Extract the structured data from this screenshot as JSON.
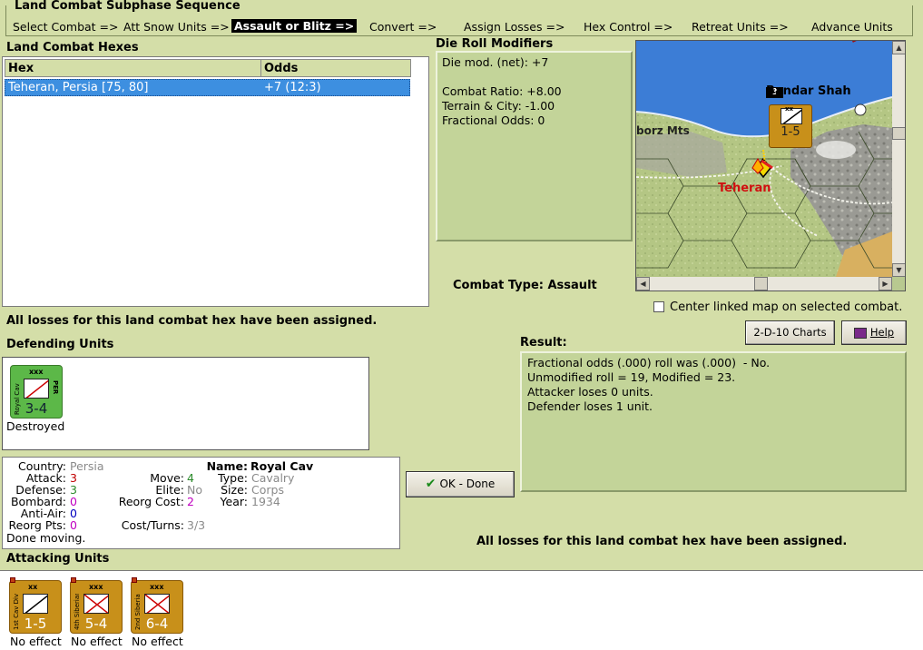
{
  "sequence": {
    "title": "Land Combat Subphase Sequence",
    "steps": [
      "Select Combat =>",
      "Att Snow Units =>",
      "Assault or Blitz =>",
      "Convert =>",
      "Assign Losses =>",
      "Hex Control =>",
      "Retreat Units =>",
      "Advance Units"
    ],
    "active_index": 2
  },
  "hexes": {
    "title": "Land Combat Hexes",
    "columns": [
      "Hex",
      "Odds"
    ],
    "rows": [
      {
        "hex": "Teheran, Persia [75, 80]",
        "odds": "+7 (12:3)"
      }
    ]
  },
  "drm": {
    "title": "Die Roll Modifiers",
    "lines": [
      "Die mod. (net): +7",
      "",
      "Combat Ratio: +8.00",
      "Terrain & City: -1.00",
      "Fractional Odds: 0"
    ]
  },
  "map": {
    "labels": {
      "bandar": "Bandar Shah",
      "elburz": "borz Mts",
      "teheran": "Teheran"
    },
    "stack_count": "3",
    "unit": {
      "size": "xx",
      "strength": "1-5",
      "name": "1st Cav"
    }
  },
  "combat_type": {
    "label": "Combat Type:",
    "value": "Assault"
  },
  "center_map_label": "Center linked map on selected combat.",
  "losses_msg": "All losses for this land combat hex have been assigned.",
  "losses_msg_right": "All losses for this land combat hex have been assigned.",
  "buttons": {
    "charts": "2-D-10 Charts",
    "help": "Help",
    "ok": "OK - Done"
  },
  "defending": {
    "title": "Defending Units",
    "units": [
      {
        "name": "Royal Cav",
        "country": "PER",
        "size": "xxx",
        "strength": "3-4",
        "status": "Destroyed",
        "color": "#5cb848"
      }
    ]
  },
  "info": {
    "country_label": "Country:",
    "country": "Persia",
    "attack_label": "Attack:",
    "attack": "3",
    "defense_label": "Defense:",
    "defense": "3",
    "bombard_label": "Bombard:",
    "bombard": "0",
    "antiair_label": "Anti-Air:",
    "antiair": "0",
    "reorg_label": "Reorg Pts:",
    "reorg": "0",
    "status": "Done moving.",
    "move_label": "Move:",
    "move": "4",
    "elite_label": "Elite:",
    "elite": "No",
    "reorg_cost_label": "Reorg Cost:",
    "reorg_cost": "2",
    "cost_turns_label": "Cost/Turns:",
    "cost_turns": "3/3",
    "name_label": "Name:",
    "name": "Royal Cav",
    "type_label": "Type:",
    "type": "Cavalry",
    "size_label": "Size:",
    "size": "Corps",
    "year_label": "Year:",
    "year": "1934"
  },
  "result": {
    "title": "Result:",
    "lines": [
      "Fractional odds (.000) roll was (.000)  - No.",
      "Unmodified roll = 19, Modified = 23.",
      "Attacker loses 0 units.",
      "Defender loses 1 unit."
    ]
  },
  "attacking": {
    "title": "Attacking Units",
    "units": [
      {
        "name": "1st Cav Div",
        "size": "xx",
        "strength": "1-5",
        "status": "No effect",
        "type": "cav"
      },
      {
        "name": "4th Siberian",
        "size": "xxx",
        "strength": "5-4",
        "status": "No effect",
        "type": "inf"
      },
      {
        "name": "2nd Siberian",
        "size": "xxx",
        "strength": "6-4",
        "status": "No effect",
        "type": "inf"
      }
    ]
  },
  "colors": {
    "background": "#d4dea8",
    "panel": "#c3d499",
    "selection": "#3d8fe0",
    "soviet": "#c8901a",
    "persia": "#5cb848"
  }
}
